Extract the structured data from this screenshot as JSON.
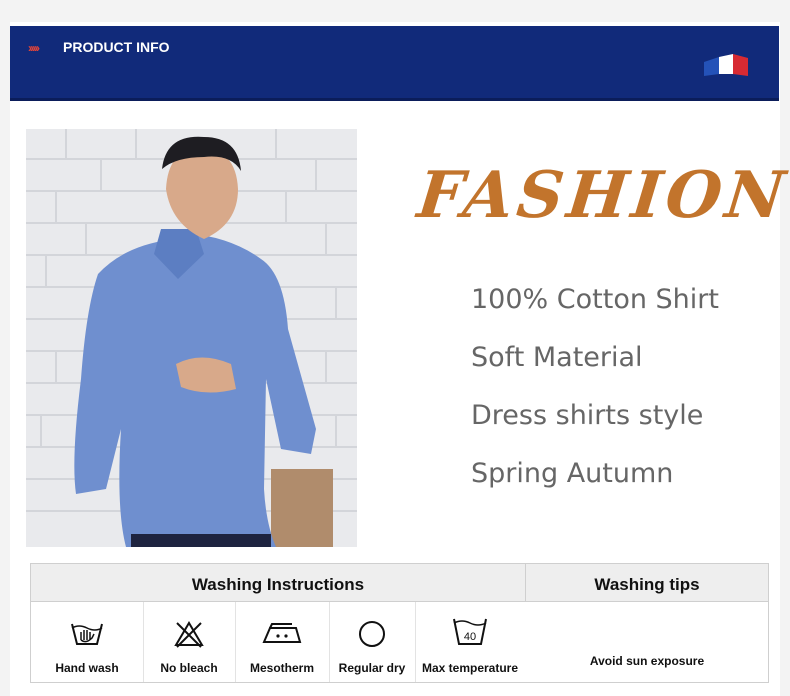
{
  "header": {
    "title": "PRODUCT INFO",
    "chevrons": "›››››"
  },
  "hero": {
    "headline": "FASHION"
  },
  "features": [
    "100% Cotton Shirt",
    "Soft Material",
    "Dress shirts style",
    "Spring Autumn"
  ],
  "washing": {
    "instructions_title": "Washing Instructions",
    "tips_title": "Washing tips",
    "items": [
      {
        "label": "Hand wash",
        "icon": "hand-wash-icon"
      },
      {
        "label": "No bleach",
        "icon": "no-bleach-icon"
      },
      {
        "label": "Mesotherm",
        "icon": "iron-icon"
      },
      {
        "label": "Regular dry",
        "icon": "tumble-dry-icon"
      },
      {
        "label": "Max temperature",
        "icon": "wash-40-icon",
        "icon_text": "40"
      }
    ],
    "tip": "Avoid sun exposure"
  },
  "colors": {
    "header_bg": "#112a7a",
    "headline": "#c2742c",
    "feature_text": "#666666",
    "chevron": "#e0443a"
  }
}
